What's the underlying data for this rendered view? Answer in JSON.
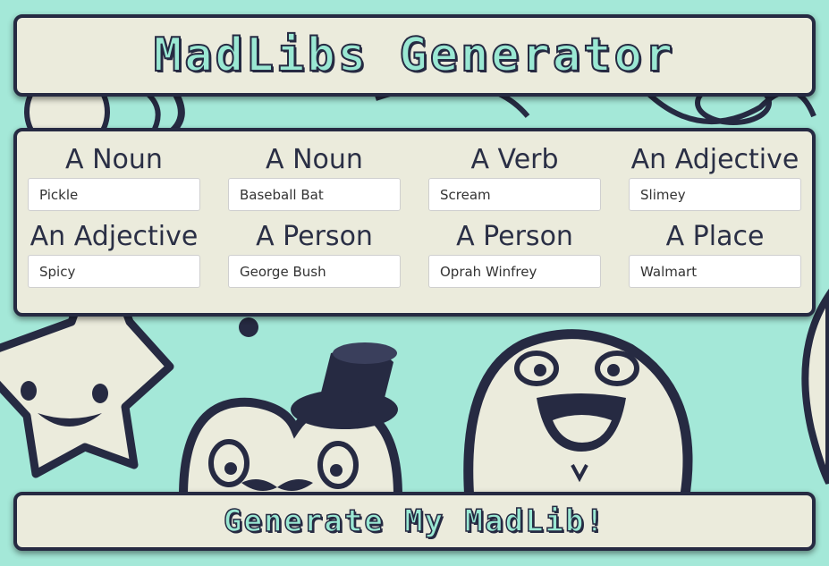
{
  "colors": {
    "background": "#a4e8d8",
    "panel": "#ebebdc",
    "ink": "#262a42",
    "title_fill": "#9ae8d3"
  },
  "header": {
    "title": "MadLibs Generator"
  },
  "form": {
    "fields": [
      {
        "label": "A Noun",
        "value": "Pickle"
      },
      {
        "label": "A Noun",
        "value": "Baseball Bat"
      },
      {
        "label": "A Verb",
        "value": "Scream"
      },
      {
        "label": "An Adjective",
        "value": "Slimey"
      },
      {
        "label": "An Adjective",
        "value": "Spicy"
      },
      {
        "label": "A Person",
        "value": "George Bush"
      },
      {
        "label": "A Person",
        "value": "Oprah Winfrey"
      },
      {
        "label": "A Place",
        "value": "Walmart"
      }
    ]
  },
  "footer": {
    "generate_label": "Generate My MadLib!"
  },
  "background_illustration": [
    "star-monster-character",
    "top-hat-monster-character",
    "fuzzy-monster-character",
    "eyeball-doodle"
  ]
}
